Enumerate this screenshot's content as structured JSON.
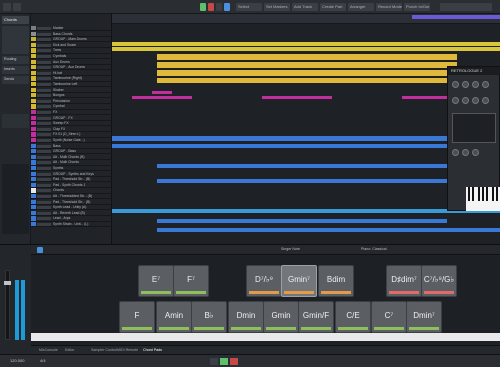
{
  "toolbar": {
    "tabs": [
      "Select",
      "Set Markers",
      "Add Track",
      "Create Part",
      "Arranger",
      "Record Mode",
      "Punch In/Out"
    ],
    "counter": "Follow"
  },
  "inspector": {
    "track_name": "Chords",
    "labels": [
      "Routing",
      "Inserts",
      "Sends"
    ]
  },
  "tracks": [
    {
      "name": "Marker",
      "color": "#7a7f86"
    },
    {
      "name": "Bass Chords",
      "color": "#8a8f96"
    },
    {
      "name": "GROUP - Main Drums",
      "color": "#c9b22d"
    },
    {
      "name": "Kick and Snare",
      "color": "#d3b930"
    },
    {
      "name": "Toms",
      "color": "#d3b930"
    },
    {
      "name": "Cymbals",
      "color": "#d3b930"
    },
    {
      "name": "Aux Drums",
      "color": "#d3b930"
    },
    {
      "name": "GROUP - Aux Drums",
      "color": "#d3b930"
    },
    {
      "name": "Hi-hat",
      "color": "#d3b930"
    },
    {
      "name": "Tambourine (Right)",
      "color": "#d3b930"
    },
    {
      "name": "Tambourine Left",
      "color": "#d3b930"
    },
    {
      "name": "Shaker",
      "color": "#d3b930"
    },
    {
      "name": "Bongos",
      "color": "#d3b930"
    },
    {
      "name": "Percussion",
      "color": "#d3b930"
    },
    {
      "name": "Cymbal",
      "color": "#d3b930"
    },
    {
      "name": "FX",
      "color": "#c42d9e"
    },
    {
      "name": "GROUP - FX",
      "color": "#c42d9e"
    },
    {
      "name": "Sweep FX",
      "color": "#c42d9e"
    },
    {
      "name": "Clap FX",
      "color": "#c42d9e"
    },
    {
      "name": "FX 01 (D_Siren L)",
      "color": "#c42d9e"
    },
    {
      "name": "Synth (Noise Gate...)",
      "color": "#c42d9e"
    },
    {
      "name": "Bass",
      "color": "#3a78d8"
    },
    {
      "name": "GROUP - Bass",
      "color": "#3a78d8"
    },
    {
      "name": "Alt - Multi Chords (B)",
      "color": "#3a78d8"
    },
    {
      "name": "Alt - Multi Chords",
      "color": "#3a78d8"
    },
    {
      "name": "Synths",
      "color": "#3a78d8"
    },
    {
      "name": "GROUP - Synths and Keys",
      "color": "#3a78d8"
    },
    {
      "name": "Pad - Threshold Str... (B)",
      "color": "#3a78d8"
    },
    {
      "name": "Pad - Synth Chords 1",
      "color": "#3a78d8"
    },
    {
      "name": "Chords",
      "color": "#e8e8e8"
    },
    {
      "name": "Alt - Thresholded Str... (B)",
      "color": "#3a78d8"
    },
    {
      "name": "Pad - Threshold Str... (B)",
      "color": "#3a78d8"
    },
    {
      "name": "Synth Lead - Unity (A)",
      "color": "#3a78d8"
    },
    {
      "name": "Alt - Reverb Lead (B)",
      "color": "#3a78d8"
    },
    {
      "name": "Lead - Arps",
      "color": "#3a78d8"
    },
    {
      "name": "Synth Strain - Unit... (L)",
      "color": "#3a78d8"
    }
  ],
  "plugin": {
    "title": "RETROLOGUE 2"
  },
  "chord_toolbar": {
    "mode_label": "Singer Note",
    "voicing_label": "Piano: Classical"
  },
  "chord_pads": [
    {
      "label": "E⁷",
      "bar": "#8fbf5a"
    },
    {
      "label": "F⁷",
      "bar": "#8fbf5a"
    },
    {
      "label": "D⁷/♭⁹",
      "bar": "#e39b4a"
    },
    {
      "label": "Gmin⁷",
      "bar": "#e39b4a",
      "active": true
    },
    {
      "label": "Bdim",
      "bar": "#e39b4a"
    },
    {
      "label": "D♯dim⁷",
      "bar": "#e36a6a"
    },
    {
      "label": "C⁷/♭⁹/G♭",
      "bar": "#e36a6a"
    },
    {
      "label": "F",
      "bar": "#8fbf5a"
    },
    {
      "label": "Amin",
      "bar": "#8fbf5a"
    },
    {
      "label": "B♭",
      "bar": "#8fbf5a"
    },
    {
      "label": "Dmin",
      "bar": "#8fbf5a"
    },
    {
      "label": "Gmin",
      "bar": "#8fbf5a"
    },
    {
      "label": "Gmin/F",
      "bar": "#8fbf5a"
    },
    {
      "label": "C/E",
      "bar": "#8fbf5a"
    },
    {
      "label": "C⁷",
      "bar": "#8fbf5a"
    },
    {
      "label": "Dmin⁷",
      "bar": "#8fbf5a"
    }
  ],
  "lower_tabs": [
    "MixConsole",
    "Editor",
    "Sampler Control",
    "MIDI Remote",
    "Chord Pads"
  ],
  "transport": {
    "tempo": "120.000",
    "signature": "4/4"
  }
}
